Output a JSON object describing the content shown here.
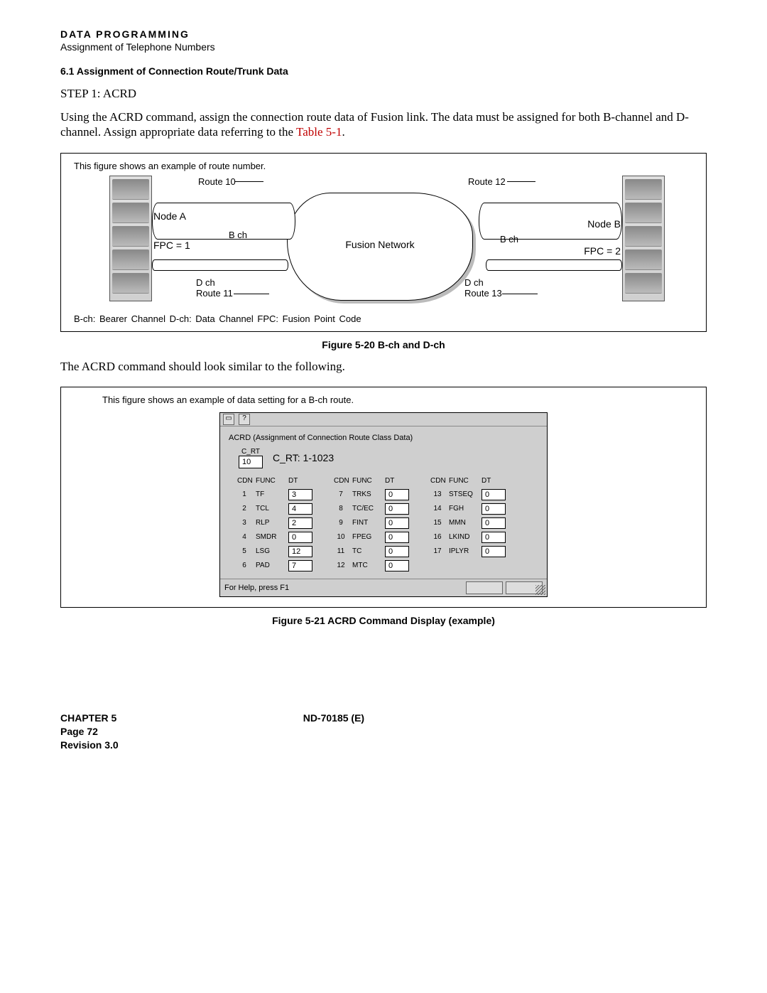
{
  "header": {
    "title": "DATA PROGRAMMING",
    "subtitle": "Assignment of Telephone Numbers"
  },
  "section": {
    "heading": "6.1   Assignment of Connection Route/Trunk Data",
    "step": "STEP 1:    ACRD",
    "para_a": "Using the ACRD command, assign the connection route data of Fusion link. The data must be assigned for both B-channel and D-channel. Assign appropriate data referring to the ",
    "table_ref": "Table 5-1",
    "para_b": "."
  },
  "figure1": {
    "note": "This figure shows an example of route number.",
    "route10": "Route 10",
    "route11": "Route 11",
    "route12": "Route 12",
    "route13": "Route 13",
    "nodeA": "Node A",
    "nodeB": "Node B",
    "fpc1": "FPC = 1",
    "fpc2": "FPC = 2",
    "bch_l": "B ch",
    "bch_r": "B ch",
    "dch_l": "D ch",
    "dch_r": "D ch",
    "cloud": "Fusion Network",
    "legend": "B-ch: Bearer Channel       D-ch: Data Channel       FPC: Fusion Point Code",
    "caption": "Figure 5-20   B-ch and D-ch"
  },
  "mid_para": "The ACRD command should look similar to the following.",
  "figure2": {
    "note": "This figure shows an example of data setting for a B-ch route.",
    "window_title": "ACRD (Assignment of Connection Route Class Data)",
    "crt_label": "C_RT",
    "crt_value": "10",
    "crt_desc": "C_RT: 1-1023",
    "col_hdrs": [
      "CDN",
      "FUNC",
      "DT"
    ],
    "columns": [
      [
        {
          "cdn": "1",
          "func": "TF",
          "dt": "3"
        },
        {
          "cdn": "2",
          "func": "TCL",
          "dt": "4"
        },
        {
          "cdn": "3",
          "func": "RLP",
          "dt": "2"
        },
        {
          "cdn": "4",
          "func": "SMDR",
          "dt": "0"
        },
        {
          "cdn": "5",
          "func": "LSG",
          "dt": "12"
        },
        {
          "cdn": "6",
          "func": "PAD",
          "dt": "7"
        }
      ],
      [
        {
          "cdn": "7",
          "func": "TRKS",
          "dt": "0"
        },
        {
          "cdn": "8",
          "func": "TC/EC",
          "dt": "0"
        },
        {
          "cdn": "9",
          "func": "FINT",
          "dt": "0"
        },
        {
          "cdn": "10",
          "func": "FPEG",
          "dt": "0"
        },
        {
          "cdn": "11",
          "func": "TC",
          "dt": "0"
        },
        {
          "cdn": "12",
          "func": "MTC",
          "dt": "0"
        }
      ],
      [
        {
          "cdn": "13",
          "func": "STSEQ",
          "dt": "0"
        },
        {
          "cdn": "14",
          "func": "FGH",
          "dt": "0"
        },
        {
          "cdn": "15",
          "func": "MMN",
          "dt": "0"
        },
        {
          "cdn": "16",
          "func": "LKIND",
          "dt": "0"
        },
        {
          "cdn": "17",
          "func": "IPLYR",
          "dt": "0"
        }
      ]
    ],
    "status": "For Help, press F1",
    "caption": "Figure 5-21   ACRD Command Display (example)"
  },
  "footer": {
    "chapter": "CHAPTER 5",
    "page": "Page 72",
    "revision": "Revision 3.0",
    "docid": "ND-70185 (E)"
  }
}
